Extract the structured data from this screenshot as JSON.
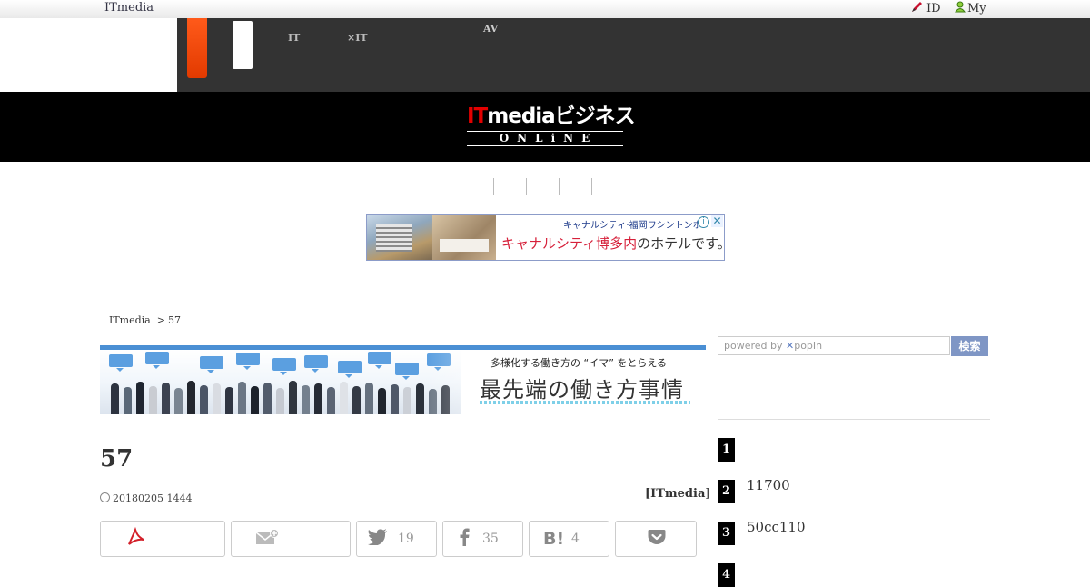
{
  "topbar": {
    "brand": "ITmedia",
    "id_label": "ID",
    "my_label": "My"
  },
  "nav": {
    "items": [
      {
        "line1": "",
        "line2": "IT"
      },
      {
        "line1": "",
        "line2": "×IT"
      },
      {
        "line1": "AV",
        "line2": ""
      }
    ]
  },
  "logo": {
    "part_red": "IT",
    "part_white": "mediaビジネス",
    "sub": "ONLiNE"
  },
  "ad": {
    "small_text": "キャナルシティ·福岡ワシントンホ",
    "big_text_red": "キャナルシティ博多内",
    "big_text_tail": "のホテルです。",
    "info": "i",
    "close": "✕"
  },
  "breadcrumb": {
    "home": "ITmedia",
    "sep": ">",
    "current": "57"
  },
  "feature": {
    "subtitle": "多様化する働き方の “イマ” をとらえる",
    "title": "最先端の働き方事情"
  },
  "article": {
    "title": "57",
    "datetime": "20180205 1444",
    "author": "[ITmedia]"
  },
  "share": {
    "twitter_count": "19",
    "facebook_count": "35",
    "hatena_count": "4"
  },
  "sidebar": {
    "search_placeholder": "powered by",
    "search_brand": "popIn",
    "search_button": "検索",
    "ranking": [
      {
        "rank": "1",
        "text": ""
      },
      {
        "rank": "2",
        "text": "11700"
      },
      {
        "rank": "3",
        "text": "50cc110"
      },
      {
        "rank": "4",
        "text": ""
      }
    ]
  },
  "colors": {
    "nav_bg": "#333333",
    "logo_bg": "#000000",
    "accent_orange": "#e23a00",
    "accent_blue": "#4a8fd4",
    "search_button": "#7f96c5"
  }
}
